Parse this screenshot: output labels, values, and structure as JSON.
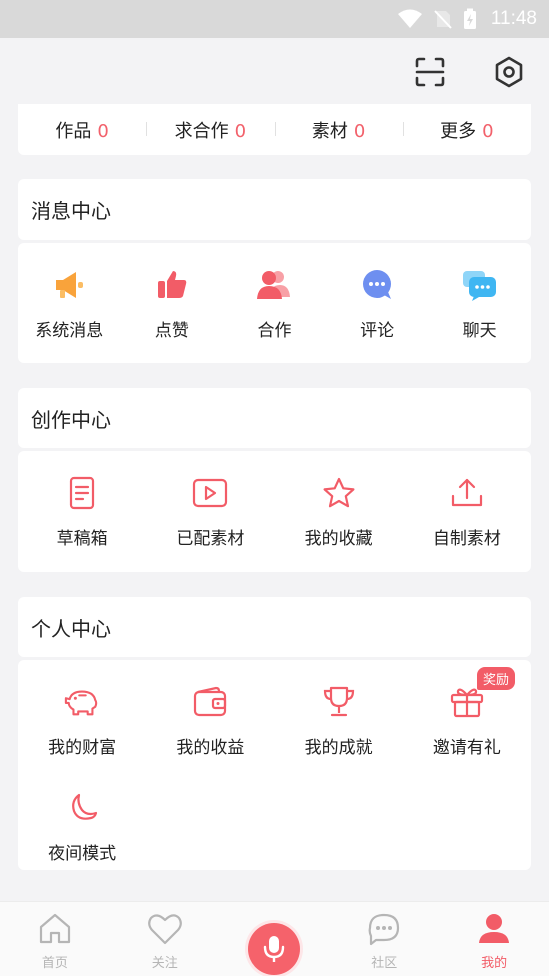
{
  "status_bar": {
    "time": "11:48"
  },
  "top_bar": {
    "scan_icon": "scan-icon",
    "settings_icon": "settings-icon"
  },
  "stats": [
    {
      "label": "作品",
      "value": "0"
    },
    {
      "label": "求合作",
      "value": "0"
    },
    {
      "label": "素材",
      "value": "0"
    },
    {
      "label": "更多",
      "value": "0"
    }
  ],
  "message_center": {
    "title": "消息中心",
    "items": [
      {
        "label": "系统消息",
        "icon": "megaphone-icon"
      },
      {
        "label": "点赞",
        "icon": "thumbs-up-icon"
      },
      {
        "label": "合作",
        "icon": "users-icon"
      },
      {
        "label": "评论",
        "icon": "comment-icon"
      },
      {
        "label": "聊天",
        "icon": "chat-icon"
      }
    ]
  },
  "creation_center": {
    "title": "创作中心",
    "items": [
      {
        "label": "草稿箱",
        "icon": "draft-icon"
      },
      {
        "label": "已配素材",
        "icon": "video-icon"
      },
      {
        "label": "我的收藏",
        "icon": "star-icon"
      },
      {
        "label": "自制素材",
        "icon": "upload-icon"
      }
    ]
  },
  "personal_center": {
    "title": "个人中心",
    "badge": "奖励",
    "items": [
      {
        "label": "我的财富",
        "icon": "piggy-bank-icon"
      },
      {
        "label": "我的收益",
        "icon": "wallet-icon"
      },
      {
        "label": "我的成就",
        "icon": "trophy-icon"
      },
      {
        "label": "邀请有礼",
        "icon": "gift-icon"
      },
      {
        "label": "夜间模式",
        "icon": "moon-icon"
      }
    ]
  },
  "tab_bar": {
    "items": [
      {
        "label": "首页",
        "icon": "home-icon"
      },
      {
        "label": "关注",
        "icon": "heart-icon"
      },
      {
        "label": "",
        "icon": "microphone-icon"
      },
      {
        "label": "社区",
        "icon": "community-icon"
      },
      {
        "label": "我的",
        "icon": "profile-icon"
      }
    ],
    "active": "我的"
  },
  "colors": {
    "accent": "#f25c67",
    "orange": "#f9a33b",
    "blue": "#5b8cf0",
    "cyan": "#3fb6f2"
  }
}
